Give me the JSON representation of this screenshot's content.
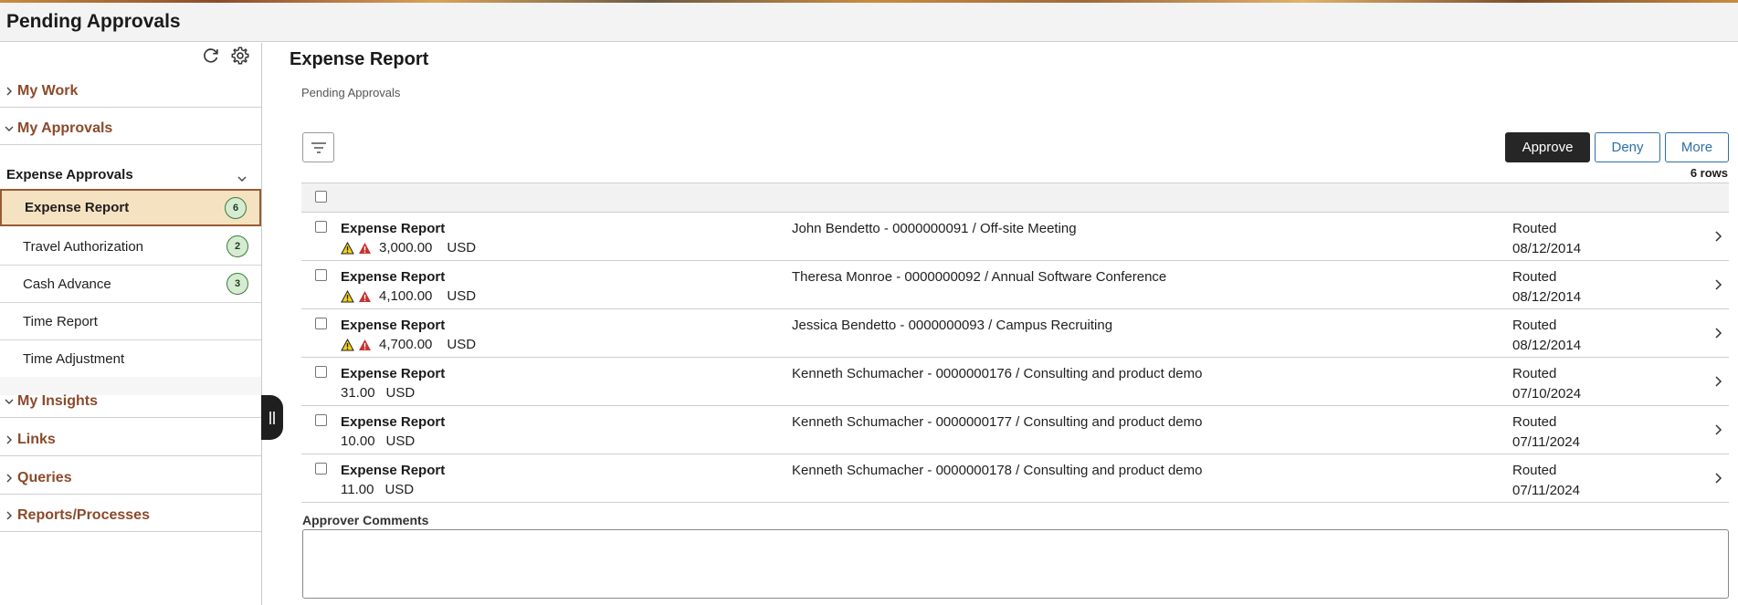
{
  "header": {
    "title": "Pending Approvals"
  },
  "sidebar": {
    "sections_top": [
      {
        "label": "My Work",
        "expanded": false
      },
      {
        "label": "My Approvals",
        "expanded": true
      }
    ],
    "group_label": "Expense Approvals",
    "items": [
      {
        "label": "Expense Report",
        "badge": "6",
        "active": true
      },
      {
        "label": "Travel Authorization",
        "badge": "2",
        "active": false
      },
      {
        "label": "Cash Advance",
        "badge": "3",
        "active": false
      },
      {
        "label": "Time Report",
        "badge": "",
        "active": false
      },
      {
        "label": "Time Adjustment",
        "badge": "",
        "active": false
      }
    ],
    "sections_bottom": [
      {
        "label": "My Insights"
      },
      {
        "label": "Links"
      },
      {
        "label": "Queries"
      },
      {
        "label": "Reports/Processes"
      }
    ]
  },
  "main": {
    "title": "Expense Report",
    "breadcrumb": "Pending Approvals",
    "actions": {
      "approve": "Approve",
      "deny": "Deny",
      "more": "More"
    },
    "row_count": "6 rows",
    "rows": [
      {
        "name": "Expense Report",
        "amount": "3,000.00",
        "currency": "USD",
        "warnings": true,
        "description": "John Bendetto - 0000000091 / Off-site Meeting",
        "status": "Routed",
        "date": "08/12/2014"
      },
      {
        "name": "Expense Report",
        "amount": "4,100.00",
        "currency": "USD",
        "warnings": true,
        "description": "Theresa Monroe - 0000000092 / Annual Software Conference",
        "status": "Routed",
        "date": "08/12/2014"
      },
      {
        "name": "Expense Report",
        "amount": "4,700.00",
        "currency": "USD",
        "warnings": true,
        "description": "Jessica Bendetto - 0000000093 / Campus Recruiting",
        "status": "Routed",
        "date": "08/12/2014"
      },
      {
        "name": "Expense Report",
        "amount": "31.00",
        "currency": "USD",
        "warnings": false,
        "description": "Kenneth Schumacher - 0000000176 / Consulting and product demo",
        "status": "Routed",
        "date": "07/10/2024"
      },
      {
        "name": "Expense Report",
        "amount": "10.00",
        "currency": "USD",
        "warnings": false,
        "description": "Kenneth Schumacher - 0000000177 / Consulting and product demo",
        "status": "Routed",
        "date": "07/11/2024"
      },
      {
        "name": "Expense Report",
        "amount": "11.00",
        "currency": "USD",
        "warnings": false,
        "description": "Kenneth Schumacher - 0000000178 / Consulting and product demo",
        "status": "Routed",
        "date": "07/11/2024"
      }
    ],
    "comments_label": "Approver Comments",
    "comments_value": ""
  },
  "colors": {
    "accent": "#8b4a2b",
    "active_bg": "#f5e2c0",
    "badge_bg": "#d5ecd3",
    "link_blue": "#2d6fa6"
  },
  "icons": {
    "refresh": "refresh-icon",
    "settings": "gear-icon",
    "filter": "filter-icon",
    "warning": "warning-icon",
    "error": "error-icon",
    "collapse": "collapse-handle-icon"
  }
}
